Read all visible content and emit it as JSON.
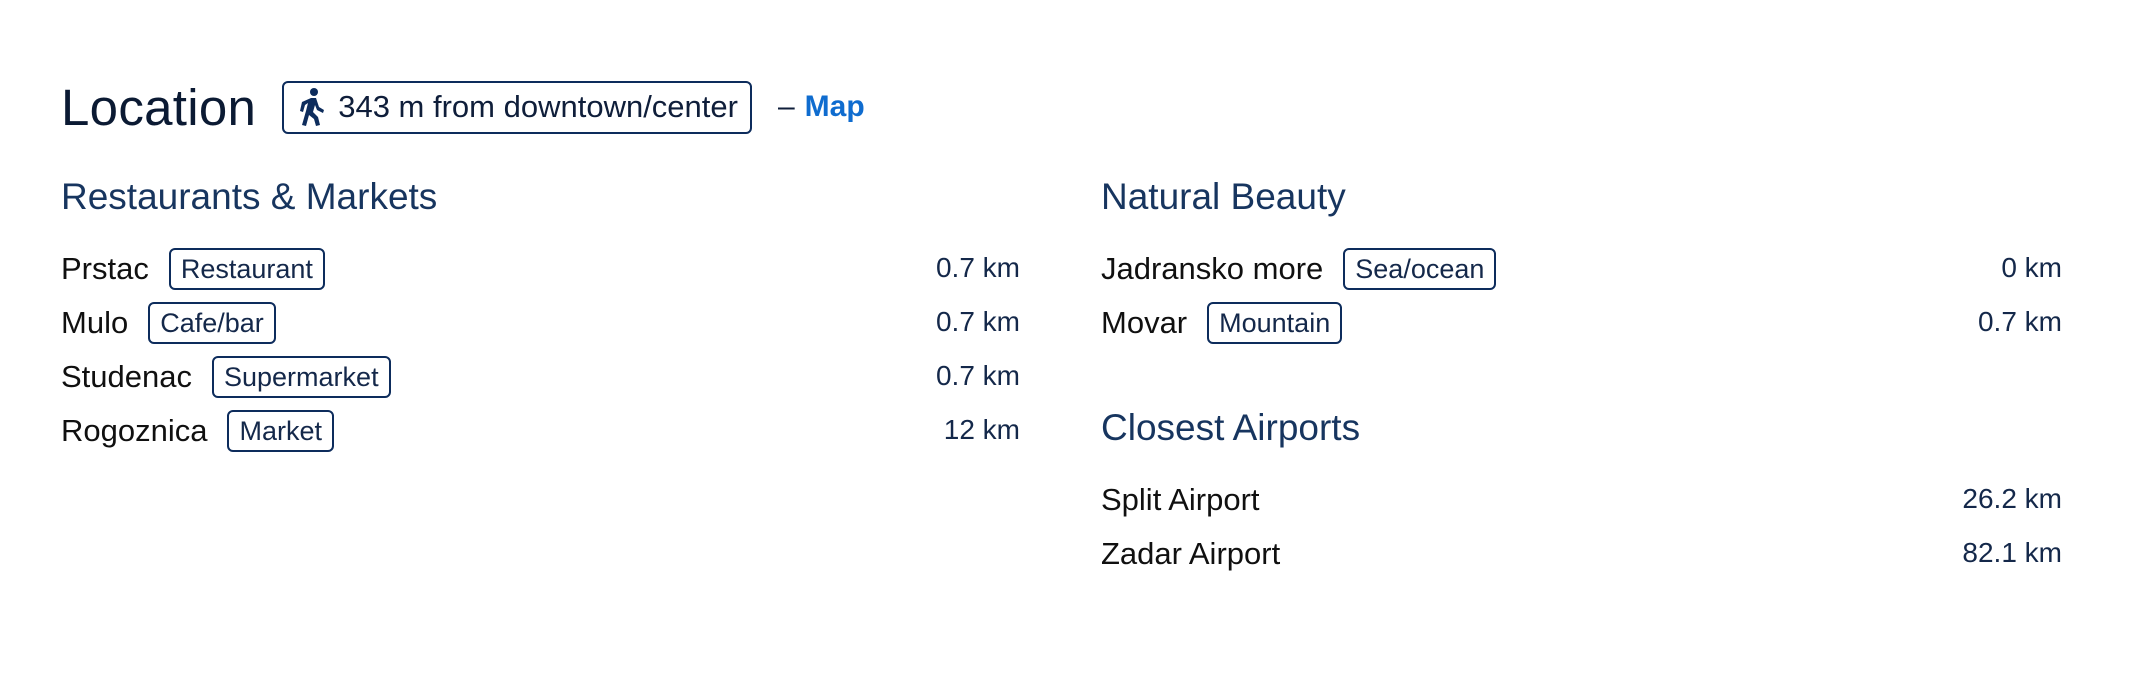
{
  "location": {
    "title": "Location",
    "walk_icon": "walking-person-icon",
    "walk_text": "343 m from downtown/center",
    "dash": "–",
    "map_link": "Map"
  },
  "restaurants": {
    "title": "Restaurants & Markets",
    "items": [
      {
        "name": "Prstac",
        "tag": "Restaurant",
        "distance": "0.7 km"
      },
      {
        "name": "Mulo",
        "tag": "Cafe/bar",
        "distance": "0.7 km"
      },
      {
        "name": "Studenac",
        "tag": "Supermarket",
        "distance": "0.7 km"
      },
      {
        "name": "Rogoznica",
        "tag": "Market",
        "distance": "12 km"
      }
    ]
  },
  "natural_beauty": {
    "title": "Natural Beauty",
    "items": [
      {
        "name": "Jadransko more",
        "tag": "Sea/ocean",
        "distance": "0 km"
      },
      {
        "name": "Movar",
        "tag": "Mountain",
        "distance": "0.7 km"
      }
    ]
  },
  "airports": {
    "title": "Closest Airports",
    "items": [
      {
        "name": "Split Airport",
        "distance": "26.2 km"
      },
      {
        "name": "Zadar Airport",
        "distance": "82.1 km"
      }
    ]
  },
  "colors": {
    "heading": "#17355f",
    "tag_border": "#0d2c5c",
    "link": "#0f6ccf"
  }
}
